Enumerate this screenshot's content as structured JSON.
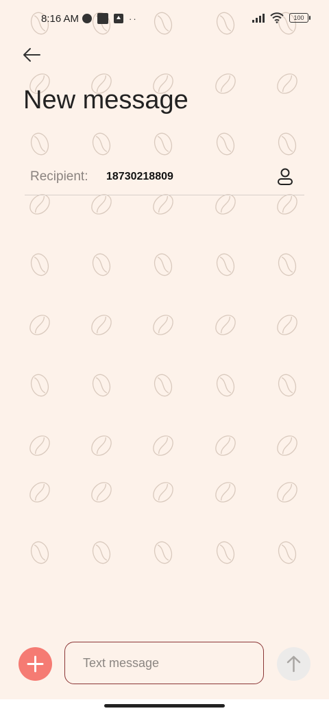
{
  "status_bar": {
    "time": "8:16 AM",
    "battery": "100",
    "icons": [
      "circle-icon",
      "square-icon",
      "upload-icon",
      "dots-icon",
      "signal-icon",
      "wifi-icon",
      "battery-icon"
    ]
  },
  "header": {
    "back_icon": "arrow-left-icon",
    "title": "New message"
  },
  "recipient": {
    "label": "Recipient:",
    "value": "18730218809",
    "contact_icon": "contact-person-icon"
  },
  "composer": {
    "add_icon": "plus-icon",
    "placeholder": "Text message",
    "value": "",
    "send_icon": "arrow-up-icon"
  },
  "colors": {
    "background": "#fdf2ea",
    "accent": "#f57b73",
    "input_border": "#8a3535",
    "send_disabled": "#ecebea"
  }
}
